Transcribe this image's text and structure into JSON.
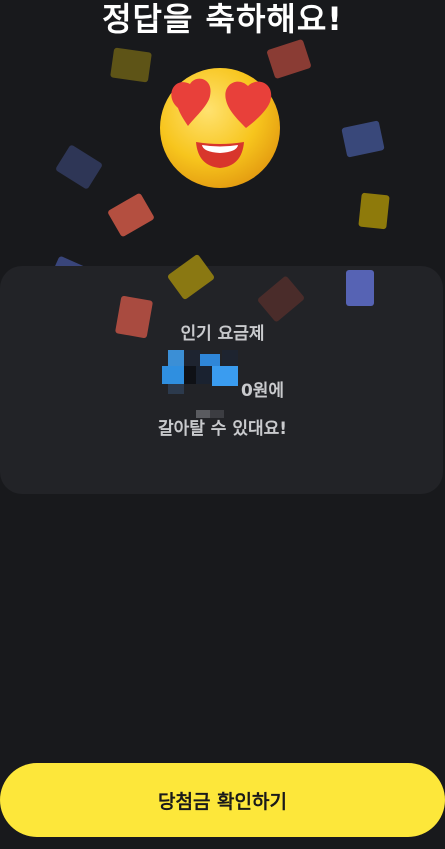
{
  "header": {
    "title": "정답을 축하해요!"
  },
  "emoji": {
    "name": "heart-eyes-emoji",
    "face_color": "#f5c21b",
    "heart_color": "#e8403a"
  },
  "result_card": {
    "plan_label": "인기 요금제",
    "price_suffix": "0원에",
    "message": "갈아탈 수 있대요!"
  },
  "colors": {
    "background": "#18191c",
    "card": "#222327",
    "accent": "#fde73a"
  },
  "cta": {
    "label": "당첨금 확인하기"
  }
}
